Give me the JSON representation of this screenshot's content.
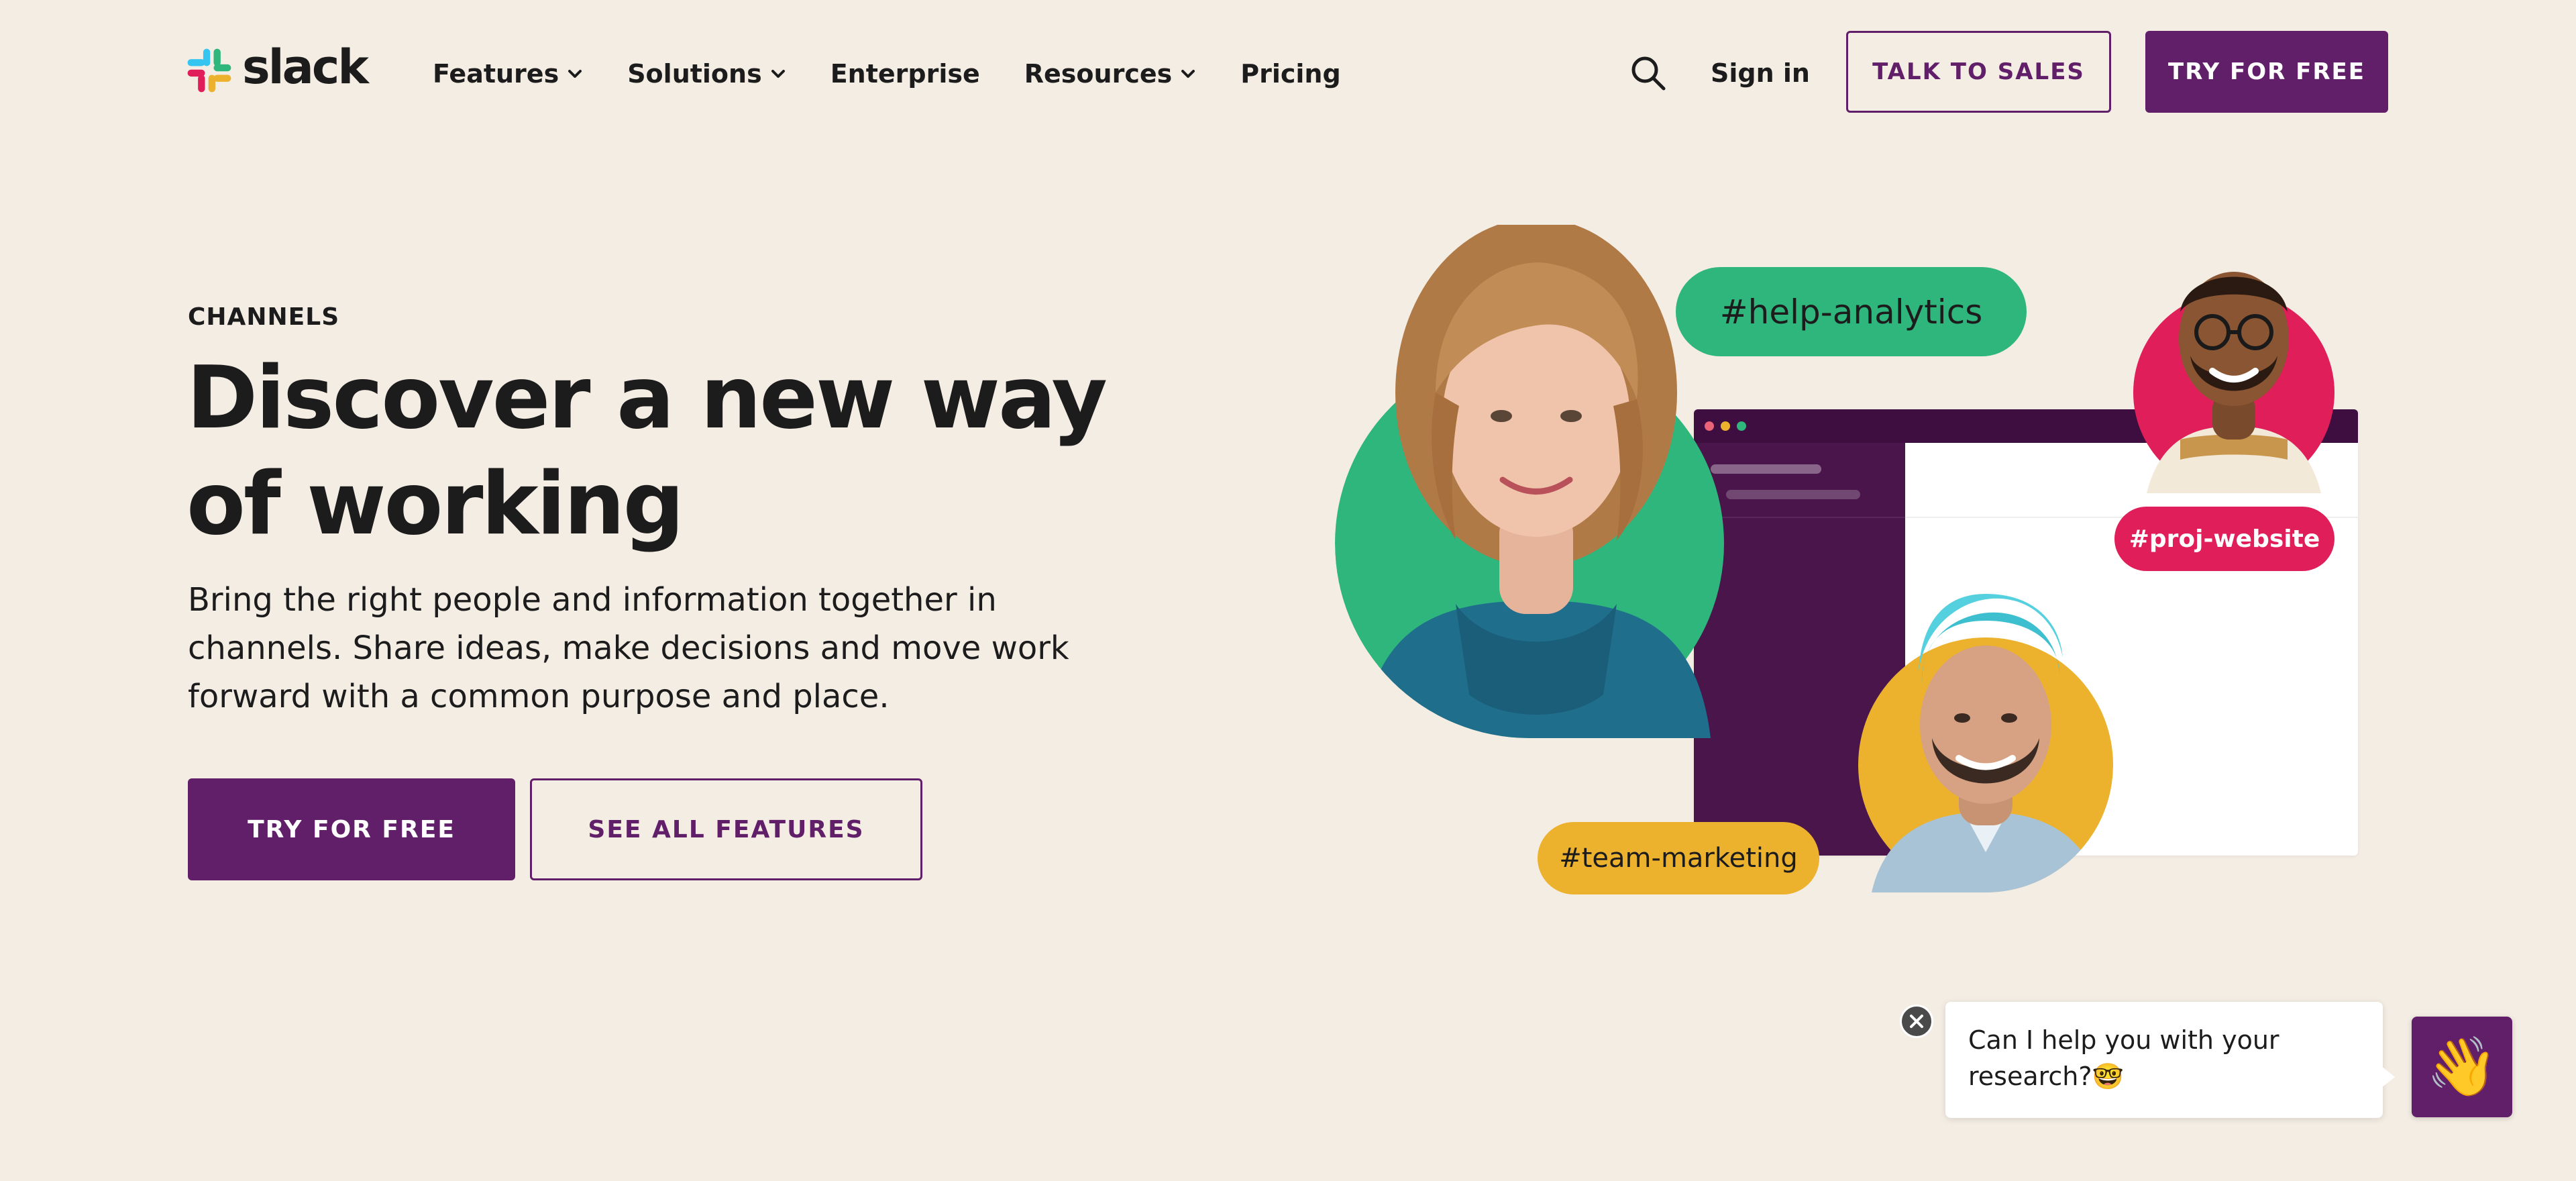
{
  "header": {
    "brand": "slack",
    "nav": [
      {
        "label": "Features",
        "has_dropdown": true
      },
      {
        "label": "Solutions",
        "has_dropdown": true
      },
      {
        "label": "Enterprise",
        "has_dropdown": false
      },
      {
        "label": "Resources",
        "has_dropdown": true
      },
      {
        "label": "Pricing",
        "has_dropdown": false
      }
    ],
    "search_icon": "search-icon",
    "sign_in": "Sign in",
    "talk_to_sales": "TALK TO SALES",
    "try_for_free": "TRY FOR FREE"
  },
  "hero": {
    "eyebrow": "CHANNELS",
    "headline": "Discover a new way of working",
    "subtext": "Bring the right people and information together in channels. Share ideas, make decisions and move work forward with a common purpose and place.",
    "primary_cta": "TRY FOR FREE",
    "secondary_cta": "SEE ALL FEATURES"
  },
  "illustration": {
    "tags": {
      "help": "#help-analytics",
      "proj": "#proj-website",
      "team": "#team-marketing"
    }
  },
  "chat": {
    "message": "Can I help you with your research?🤓",
    "launcher_emoji": "👋",
    "close_icon": "close-icon"
  },
  "colors": {
    "background": "#F4EDE4",
    "aubergine": "#611F69",
    "green": "#2EB67D",
    "red": "#E01E5A",
    "yellow": "#ECB22E",
    "blue": "#36C5F0"
  }
}
